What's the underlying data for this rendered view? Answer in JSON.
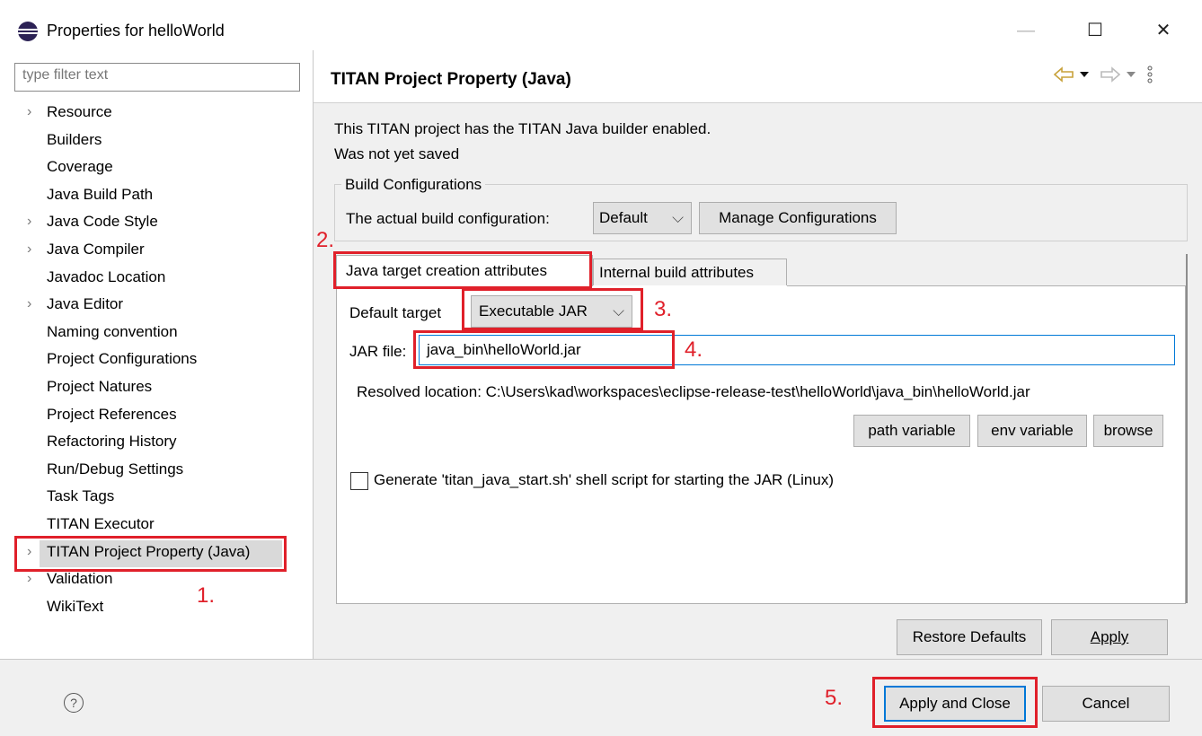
{
  "window": {
    "title": "Properties for helloWorld",
    "minimize_glyph": "—",
    "maximize_glyph": "☐",
    "close_glyph": "✕"
  },
  "filter": {
    "placeholder": "type filter text"
  },
  "tree": {
    "items": [
      {
        "label": "Resource",
        "expandable": true
      },
      {
        "label": "Builders",
        "expandable": false
      },
      {
        "label": "Coverage",
        "expandable": false
      },
      {
        "label": "Java Build Path",
        "expandable": false
      },
      {
        "label": "Java Code Style",
        "expandable": true
      },
      {
        "label": "Java Compiler",
        "expandable": true
      },
      {
        "label": "Javadoc Location",
        "expandable": false
      },
      {
        "label": "Java Editor",
        "expandable": true
      },
      {
        "label": "Naming convention",
        "expandable": false
      },
      {
        "label": "Project Configurations",
        "expandable": false
      },
      {
        "label": "Project Natures",
        "expandable": false
      },
      {
        "label": "Project References",
        "expandable": false
      },
      {
        "label": "Refactoring History",
        "expandable": false
      },
      {
        "label": "Run/Debug Settings",
        "expandable": false
      },
      {
        "label": "Task Tags",
        "expandable": false
      },
      {
        "label": "TITAN Executor",
        "expandable": false
      },
      {
        "label": "TITAN Project Property (Java)",
        "expandable": true,
        "selected": true
      },
      {
        "label": "Validation",
        "expandable": true
      },
      {
        "label": "WikiText",
        "expandable": false
      }
    ]
  },
  "page": {
    "title": "TITAN Project Property (Java)",
    "description_line1": "This TITAN project has the TITAN Java builder enabled.",
    "description_line2": "Was not yet saved",
    "nav_icons": [
      "back-arrow-icon",
      "dropdown-icon",
      "forward-arrow-icon",
      "dropdown-icon",
      "menu-icon"
    ]
  },
  "build_configurations": {
    "group_label": "Build Configurations",
    "label": "The actual build configuration:",
    "selected": "Default",
    "manage_button": "Manage Configurations"
  },
  "tabs": [
    {
      "label": "Java target creation attributes",
      "active": true
    },
    {
      "label": "Internal build attributes",
      "active": false
    }
  ],
  "java_target": {
    "default_target_label": "Default target",
    "default_target_value": "Executable JAR",
    "jar_label": "JAR file:",
    "jar_value": "java_bin\\helloWorld.jar",
    "resolved": "Resolved location: C:\\Users\\kad\\workspaces\\eclipse-release-test\\helloWorld\\java_bin\\helloWorld.jar",
    "path_variable_button": "path variable",
    "env_variable_button": "env variable",
    "browse_button": "browse",
    "generate_checkbox_label": "Generate 'titan_java_start.sh' shell script for starting the JAR (Linux)",
    "generate_checked": false
  },
  "buttons": {
    "restore_defaults": "Restore Defaults",
    "apply": "Apply",
    "apply_and_close": "Apply and Close",
    "cancel": "Cancel",
    "help": "?"
  },
  "annotations": {
    "n1": "1.",
    "n2": "2.",
    "n3": "3.",
    "n4": "4.",
    "n5": "5.",
    "color": "#e0202a"
  },
  "colors": {
    "selection": "#d9d9d9",
    "focus_border": "#0078d7",
    "dialog_bg": "#f0f0f0"
  }
}
